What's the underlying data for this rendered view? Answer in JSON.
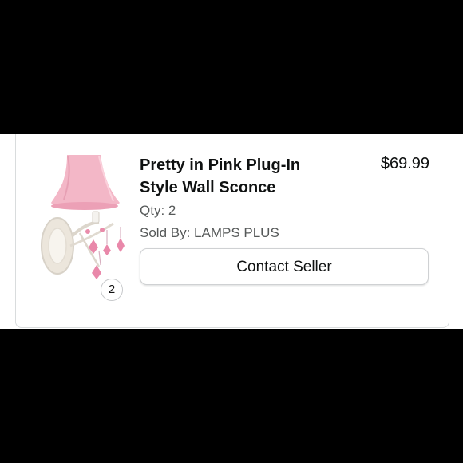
{
  "order_item": {
    "title": "Pretty in Pink Plug-In Style Wall Sconce",
    "price": "$69.99",
    "qty_label": "Qty: 2",
    "sold_by_label": "Sold By: LAMPS PLUS",
    "image_qty_badge": "2",
    "product_image_icon": "pink-wall-sconce-image",
    "contact_button_label": "Contact Seller"
  },
  "colors": {
    "background": "#000000",
    "card": "#ffffff",
    "shade_pink": "#f3b7c7",
    "cut_header_green": "#1e6b3a",
    "secondary_text": "#565959"
  }
}
